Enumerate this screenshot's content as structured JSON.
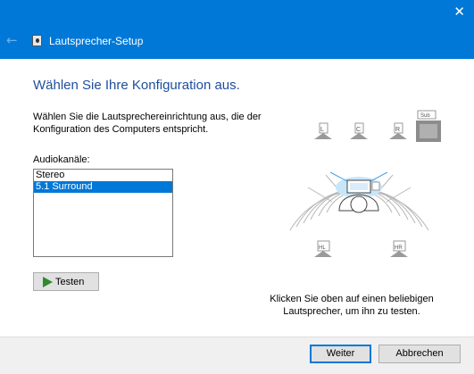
{
  "window": {
    "title": "Lautsprecher-Setup"
  },
  "main": {
    "heading": "Wählen Sie Ihre Konfiguration aus.",
    "description": "Wählen Sie die Lautsprechereinrichtung aus, die der Konfiguration des Computers entspricht.",
    "audio_channels_label": "Audiokanäle:",
    "channels": [
      "Stereo",
      "5.1 Surround"
    ],
    "selected_channel": "5.1 Surround",
    "test_button": "Testen",
    "hint": "Klicken Sie oben auf einen beliebigen Lautsprecher, um ihn zu testen."
  },
  "diagram": {
    "speakers": {
      "left": "L",
      "center": "C",
      "right": "R",
      "subwoofer": "Sub",
      "rear_left": "HL",
      "rear_right": "HR"
    }
  },
  "footer": {
    "next_button": "Weiter",
    "cancel_button": "Abbrechen"
  },
  "colors": {
    "titlebar": "#0078d7",
    "accent": "#0078d7",
    "heading": "#1e4e9c"
  }
}
